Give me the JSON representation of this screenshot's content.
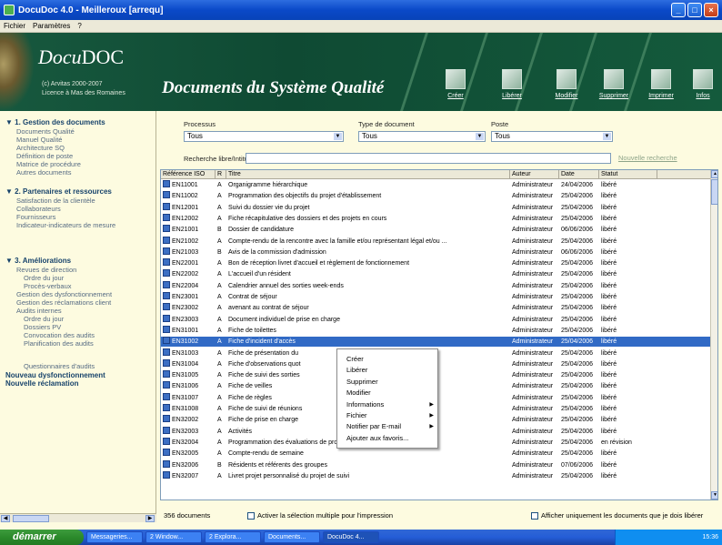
{
  "window": {
    "title": "DocuDoc 4.0 - Meilleroux [arrequ]"
  },
  "menu": [
    "Fichier",
    "Paramètres",
    "?"
  ],
  "banner": {
    "logo_pre": "Docu",
    "logo_bold": "DOC",
    "copyright_1": "(c) Arvitas 2000-2007",
    "copyright_2": "Licence à Mas des Romaines",
    "title": "Documents du Système Qualité"
  },
  "toolbar": [
    {
      "label": "Créer",
      "icon": "create-icon"
    },
    {
      "label": "Libérer",
      "icon": "release-icon"
    },
    {
      "label": "Modifier",
      "icon": "edit-icon"
    },
    {
      "label": "Supprimer",
      "icon": "delete-icon"
    },
    {
      "label": "Imprimer",
      "icon": "print-icon"
    },
    {
      "label": "Infos",
      "icon": "info-icon"
    }
  ],
  "sidebar": {
    "sections": [
      {
        "title": "1. Gestion des documents",
        "items": [
          "Documents Qualité",
          "Manuel Qualité",
          "Architecture SQ",
          "Définition de poste",
          "Matrice de procédure",
          "Autres documents"
        ]
      },
      {
        "title": "2. Partenaires et ressources",
        "items": [
          "Satisfaction de la clientèle",
          "Collaborateurs",
          "Fournisseurs",
          "Indicateur-indicateurs de mesure"
        ]
      },
      {
        "title": "3. Améliorations",
        "items": [
          "Revues de direction",
          "Ordre du jour",
          "Procès-verbaux",
          "Gestion des dysfonctionnement",
          "Gestion des réclamations client",
          "Audits internes",
          "Ordre du jour",
          "Dossiers PV",
          "Convocation des audits",
          "Planification des audits",
          "Questionnaires d'audits"
        ]
      }
    ],
    "links": [
      "Nouveau dysfonctionnement",
      "Nouvelle réclamation"
    ]
  },
  "filters": {
    "process_label": "Processus",
    "process_value": "Tous",
    "doctype_label": "Type de document",
    "doctype_value": "Tous",
    "post_label": "Poste",
    "post_value": "Tous",
    "search_label": "Recherche libre/Intitulé :",
    "new_search": "Nouvelle recherche"
  },
  "grid": {
    "columns": [
      "Référence ISO",
      "R",
      "Titre",
      "Auteur",
      "Date",
      "Statut"
    ],
    "rows": [
      [
        "EN11001",
        "A",
        "Organigramme hiérarchique",
        "Administrateur",
        "24/04/2006",
        "libéré"
      ],
      [
        "EN11002",
        "A",
        "Programmation des objectifs du projet d'établissement",
        "Administrateur",
        "25/04/2006",
        "libéré"
      ],
      [
        "EN12001",
        "A",
        "Suivi du dossier vie du projet",
        "Administrateur",
        "25/04/2006",
        "libéré"
      ],
      [
        "EN12002",
        "A",
        "Fiche récapitulative des dossiers et des projets en cours",
        "Administrateur",
        "25/04/2006",
        "libéré"
      ],
      [
        "EN21001",
        "B",
        "Dossier de candidature",
        "Administrateur",
        "06/06/2006",
        "libéré"
      ],
      [
        "EN21002",
        "A",
        "Compte-rendu de la rencontre avec la famille et/ou représentant légal et/ou ...",
        "Administrateur",
        "25/04/2006",
        "libéré"
      ],
      [
        "EN21003",
        "B",
        "Avis de la commission d'admission",
        "Administrateur",
        "06/06/2006",
        "libéré"
      ],
      [
        "EN22001",
        "A",
        "Bon de réception livret d'accueil et règlement de fonctionnement",
        "Administrateur",
        "25/04/2006",
        "libéré"
      ],
      [
        "EN22002",
        "A",
        "L'accueil d'un résident",
        "Administrateur",
        "25/04/2006",
        "libéré"
      ],
      [
        "EN22004",
        "A",
        "Calendrier annuel des sorties week-ends",
        "Administrateur",
        "25/04/2006",
        "libéré"
      ],
      [
        "EN23001",
        "A",
        "Contrat de séjour",
        "Administrateur",
        "25/04/2006",
        "libéré"
      ],
      [
        "EN23002",
        "A",
        "avenant au contrat de séjour",
        "Administrateur",
        "25/04/2006",
        "libéré"
      ],
      [
        "EN23003",
        "A",
        "Document individuel de prise en charge",
        "Administrateur",
        "25/04/2006",
        "libéré"
      ],
      [
        "EN31001",
        "A",
        "Fiche de toilettes",
        "Administrateur",
        "25/04/2006",
        "libéré"
      ],
      [
        "EN31002",
        "A",
        "Fiche d'incident d'accès",
        "Administrateur",
        "25/04/2006",
        "libéré"
      ],
      [
        "EN31003",
        "A",
        "Fiche de présentation du",
        "Administrateur",
        "25/04/2006",
        "libéré"
      ],
      [
        "EN31004",
        "A",
        "Fiche d'observations quot",
        "Administrateur",
        "25/04/2006",
        "libéré"
      ],
      [
        "EN31005",
        "A",
        "Fiche de suivi des sorties",
        "Administrateur",
        "25/04/2006",
        "libéré"
      ],
      [
        "EN31006",
        "A",
        "Fiche de veilles",
        "Administrateur",
        "25/04/2006",
        "libéré"
      ],
      [
        "EN31007",
        "A",
        "Fiche de règles",
        "Administrateur",
        "25/04/2006",
        "libéré"
      ],
      [
        "EN31008",
        "A",
        "Fiche de suivi de réunions",
        "Administrateur",
        "25/04/2006",
        "libéré"
      ],
      [
        "EN32002",
        "A",
        "Fiche de prise en charge",
        "Administrateur",
        "25/04/2006",
        "libéré"
      ],
      [
        "EN32003",
        "A",
        "Activités",
        "Administrateur",
        "25/04/2006",
        "libéré"
      ],
      [
        "EN32004",
        "A",
        "Programmation des évaluations de projet",
        "Administrateur",
        "25/04/2006",
        "en révision"
      ],
      [
        "EN32005",
        "A",
        "Compte-rendu de semaine",
        "Administrateur",
        "25/04/2006",
        "libéré"
      ],
      [
        "EN32006",
        "B",
        "Résidents et référents des groupes",
        "Administrateur",
        "07/06/2006",
        "libéré"
      ],
      [
        "EN32007",
        "A",
        "Livret projet personnalisé du projet de suivi",
        "Administrateur",
        "25/04/2006",
        "libéré"
      ]
    ],
    "selected_row": 14
  },
  "context_menu": [
    {
      "label": "Créer",
      "submenu": false
    },
    {
      "label": "Libérer",
      "submenu": false
    },
    {
      "label": "Supprimer",
      "submenu": false
    },
    {
      "label": "Modifier",
      "submenu": false
    },
    {
      "label": "Informations",
      "submenu": true
    },
    {
      "label": "Fichier",
      "submenu": true
    },
    {
      "label": "Notifier par E-mail",
      "submenu": true
    },
    {
      "label": "Ajouter aux favoris...",
      "submenu": false
    }
  ],
  "footer": {
    "count": "356 documents",
    "multi_select": "Activer la sélection multiple pour l'impression",
    "only_docs": "Afficher uniquement les documents que je dois libérer"
  },
  "taskbar": {
    "start": "démarrer",
    "tasks": [
      "Messageries...",
      "2 Window...",
      "2 Explora...",
      "Documents...",
      "DocuDoc 4..."
    ],
    "clock": "15:36"
  },
  "colors": {
    "banner": "#145a3c",
    "selection": "#316ac5",
    "section_title": "#17436b"
  }
}
